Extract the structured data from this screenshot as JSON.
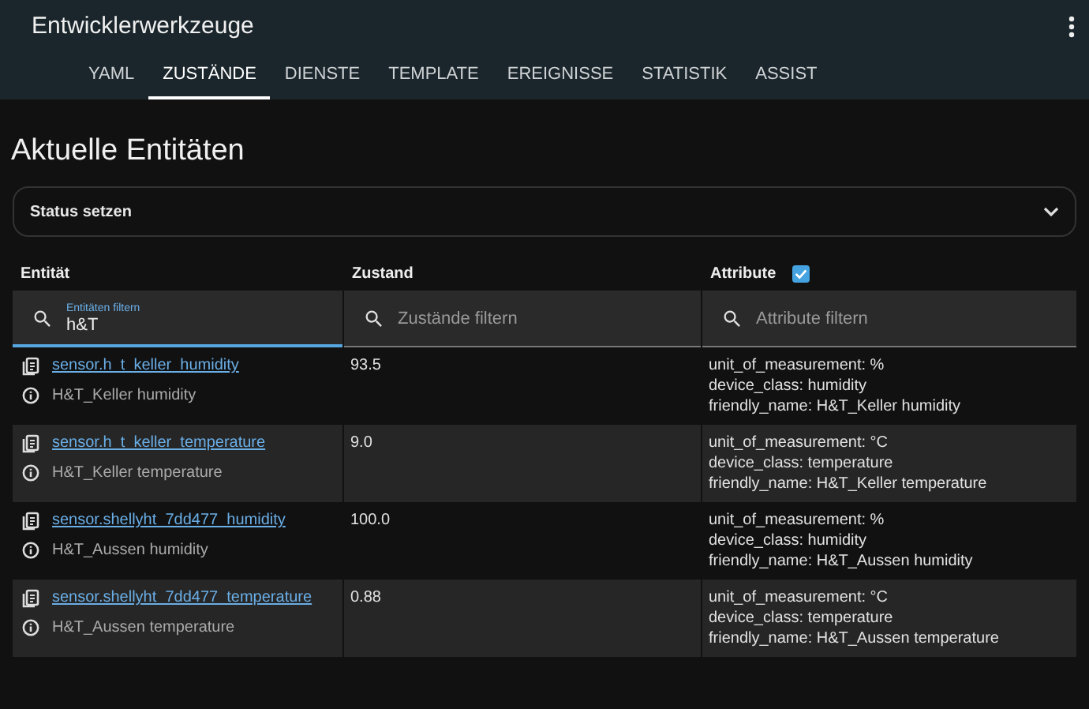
{
  "header": {
    "title": "Entwicklerwerkzeuge"
  },
  "tabs": [
    {
      "label": "YAML",
      "selected": false
    },
    {
      "label": "ZUSTÄNDE",
      "selected": true
    },
    {
      "label": "DIENSTE",
      "selected": false
    },
    {
      "label": "TEMPLATE",
      "selected": false
    },
    {
      "label": "EREIGNISSE",
      "selected": false
    },
    {
      "label": "STATISTIK",
      "selected": false
    },
    {
      "label": "ASSIST",
      "selected": false
    }
  ],
  "page_title": "Aktuelle Entitäten",
  "set_state": {
    "title": "Status setzen",
    "expanded": false
  },
  "table": {
    "columns": [
      "Entität",
      "Zustand",
      "Attribute"
    ],
    "attributes_checked": true,
    "filters": [
      {
        "label": "Entitäten filtern",
        "value": "h&T",
        "focused": true
      },
      {
        "placeholder": "Zustände filtern",
        "focused": false
      },
      {
        "placeholder": "Attribute filtern",
        "focused": false
      }
    ],
    "rows": [
      {
        "entity_id": "sensor.h_t_keller_humidity",
        "name": "H&T_Keller humidity",
        "state": "93.5",
        "attributes": [
          "unit_of_measurement: %",
          "device_class: humidity",
          "friendly_name: H&T_Keller humidity"
        ]
      },
      {
        "entity_id": "sensor.h_t_keller_temperature",
        "name": "H&T_Keller temperature",
        "state": "9.0",
        "attributes": [
          "unit_of_measurement: °C",
          "device_class: temperature",
          "friendly_name: H&T_Keller temperature"
        ]
      },
      {
        "entity_id": "sensor.shellyht_7dd477_humidity",
        "name": "H&T_Aussen humidity",
        "state": "100.0",
        "attributes": [
          "unit_of_measurement: %",
          "device_class: humidity",
          "friendly_name: H&T_Aussen humidity"
        ]
      },
      {
        "entity_id": "sensor.shellyht_7dd477_temperature",
        "name": "H&T_Aussen temperature",
        "state": "0.88",
        "attributes": [
          "unit_of_measurement: °C",
          "device_class: temperature",
          "friendly_name: H&T_Aussen temperature"
        ]
      }
    ]
  }
}
